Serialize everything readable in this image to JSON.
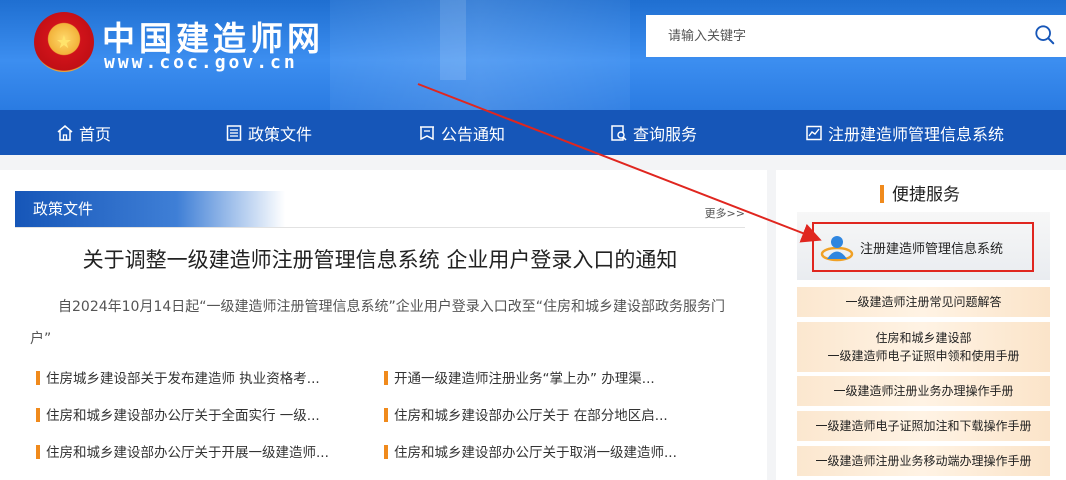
{
  "header": {
    "site_title": "中国建造师网",
    "site_url": "www.coc.gov.cn",
    "search_placeholder": "请输入关键字"
  },
  "nav": {
    "items": [
      {
        "label": "首页",
        "icon": "home-icon"
      },
      {
        "label": "政策文件",
        "icon": "document-icon"
      },
      {
        "label": "公告通知",
        "icon": "notice-icon"
      },
      {
        "label": "查询服务",
        "icon": "query-icon"
      },
      {
        "label": "注册建造师管理信息系统",
        "icon": "chart-icon"
      }
    ]
  },
  "policy": {
    "section_title": "政策文件",
    "more_label": "更多>>",
    "headline": "关于调整一级建造师注册管理信息系统 企业用户登录入口的通知",
    "summary": "自2024年10月14日起“一级建造师注册管理信息系统”企业用户登录入口改至“住房和城乡建设部政务服务门户”",
    "news": [
      "住房城乡建设部关于发布建造师 执业资格考...",
      "开通一级建造师注册业务“掌上办” 办理渠...",
      "住房和城乡建设部办公厅关于全面实行 一级...",
      "住房和城乡建设部办公厅关于 在部分地区启...",
      "住房和城乡建设部办公厅关于开展一级建造师...",
      "住房和城乡建设部办公厅关于取消一级建造师..."
    ]
  },
  "services": {
    "title": "便捷服务",
    "system_label": "注册建造师管理信息系统",
    "items": [
      {
        "line1": "一级建造师注册常见问题解答",
        "line2": ""
      },
      {
        "line1": "住房和城乡建设部",
        "line2": "一级建造师电子证照申领和使用手册"
      },
      {
        "line1": "一级建造师注册业务办理操作手册",
        "line2": ""
      },
      {
        "line1": "一级建造师电子证照加注和下载操作手册",
        "line2": ""
      },
      {
        "line1": "一级建造师注册业务移动端办理操作手册",
        "line2": ""
      }
    ]
  },
  "colors": {
    "header_blue": "#2a7be2",
    "nav_blue": "#1656b8",
    "accent_orange": "#f08a1c",
    "highlight_red": "#e0261f"
  }
}
